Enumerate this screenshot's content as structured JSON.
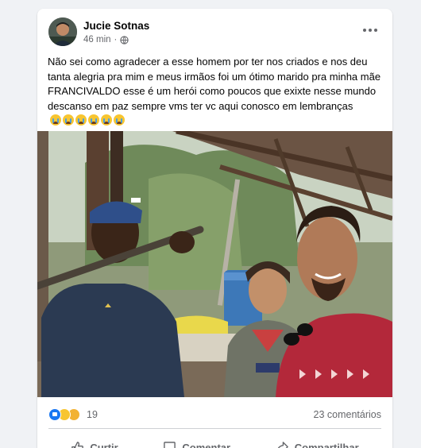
{
  "post": {
    "author": "Jucie Sotnas",
    "time": "46 min",
    "separator": "·",
    "audience_icon": "globe-icon",
    "text": "Não sei como agradecer a esse homem por ter nos criados e nos deu tanta alegria pra mim e  meus irmãos foi um ótimo marido pra minha mãe FRANCIVALDO esse é um herói como poucos que exixte nesse mundo descanso em paz sempre vms ter vc aqui conosco em lembranças",
    "emoji_count": 6,
    "emoji_icon": "crying-face-icon",
    "more_icon": "more-options-icon"
  },
  "reactions": {
    "icons": [
      "like-icon",
      "sad-icon",
      "care-icon"
    ],
    "count": "19",
    "comments": "23 comentários"
  },
  "actions": {
    "like": "Curtir",
    "comment": "Comentar",
    "share": "Compartilhar"
  },
  "colors": {
    "background": "#f0f2f5",
    "card": "#ffffff",
    "secondary_text": "#65676b",
    "like_blue": "#1877f2"
  }
}
